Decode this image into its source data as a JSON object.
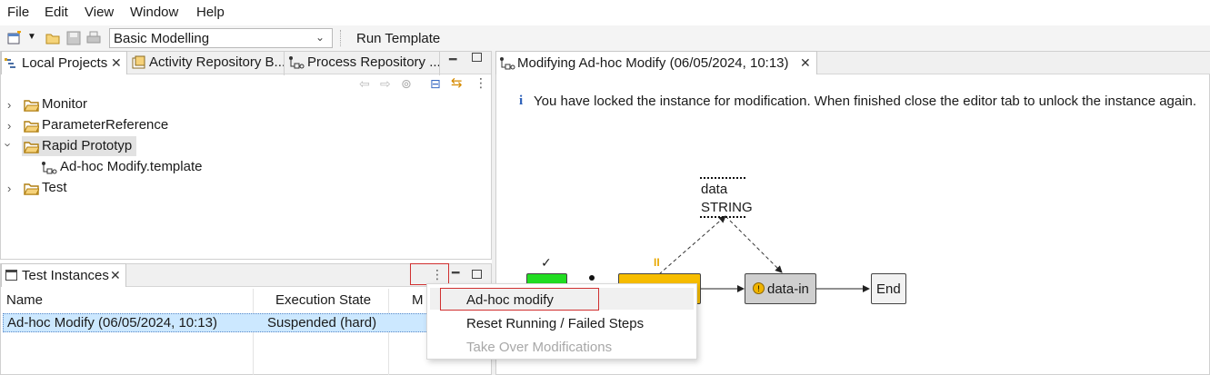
{
  "menubar": {
    "items": [
      "File",
      "Edit",
      "View",
      "Window",
      "Help"
    ]
  },
  "toolbar": {
    "perspective_value": "Basic Modelling",
    "run_template_label": "Run Template",
    "icons": [
      "new-wizard-icon",
      "open-folder-icon",
      "save-icon",
      "print-icon"
    ]
  },
  "left_top_pane": {
    "tabs": [
      {
        "label": "Local Projects",
        "active": true
      },
      {
        "label": "Activity Repository B...",
        "active": false
      },
      {
        "label": "Process Repository ...",
        "active": false
      }
    ],
    "tree": [
      {
        "label": "Monitor",
        "expanded": false
      },
      {
        "label": "ParameterReference",
        "expanded": false
      },
      {
        "label": "Rapid Prototyp",
        "expanded": true,
        "selected": true
      },
      {
        "label": "Ad-hoc Modify.template",
        "child": true
      },
      {
        "label": "Test",
        "expanded": false
      }
    ]
  },
  "test_instances": {
    "tab_label": "Test Instances",
    "columns": [
      "Name",
      "Execution State",
      "M"
    ],
    "rows": [
      {
        "name": "Ad-hoc Modify (06/05/2024, 10:13)",
        "state": "Suspended (hard)"
      }
    ]
  },
  "context_menu": {
    "items": [
      {
        "label": "Ad-hoc modify",
        "enabled": true,
        "highlighted": true
      },
      {
        "label": "Reset Running / Failed Steps",
        "enabled": true
      },
      {
        "label": "Take Over Modifications",
        "enabled": false
      }
    ]
  },
  "editor": {
    "tab_label": "Modifying Ad-hoc Modify (06/05/2024, 10:13)",
    "info_icon": "info-icon",
    "info_text": "You have locked the instance for modification. When finished close the editor tab to unlock the instance again.",
    "diagram": {
      "data_object": {
        "name": "data",
        "type": "STRING"
      },
      "start_mark": "✓",
      "paused_mark": "II",
      "nodes": [
        "data-in",
        "End"
      ],
      "colors": {
        "start": "#22dd22",
        "running": "#f7bd00",
        "task": "#cfcfcf",
        "end": "#f2f2f2",
        "highlight": "#cc2222"
      }
    }
  }
}
